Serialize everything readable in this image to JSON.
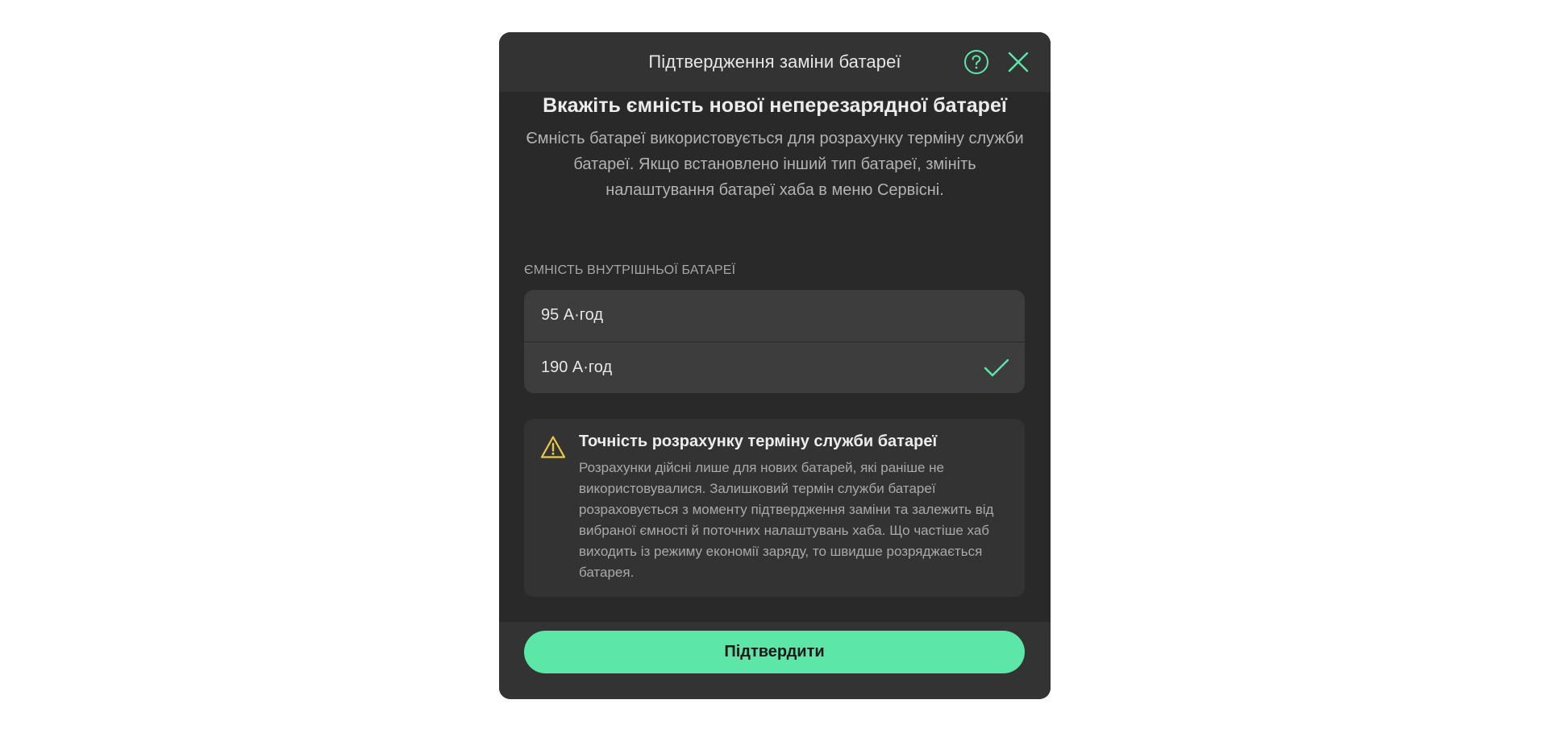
{
  "colors": {
    "accent": "#5ce6a8",
    "warning": "#e8c94a",
    "modal_background": "#292929",
    "header_background": "#333333",
    "option_background": "#3d3d3d"
  },
  "header": {
    "title": "Підтвердження заміни батареї",
    "help_icon": "help-circle-icon",
    "close_icon": "close-icon"
  },
  "main": {
    "heading": "Вкажіть ємність нової неперезарядної батареї",
    "description": "Ємність батареї використовується для розрахунку терміну служби батареї. Якщо встановлено інший тип батареї, змініть налаштування батареї хаба в меню Сервісні."
  },
  "capacity": {
    "label": "ЄМНІСТЬ ВНУТРІШНЬОЇ БАТАРЕЇ",
    "options": [
      {
        "label": "95 А·год",
        "selected": false
      },
      {
        "label": "190 А·год",
        "selected": true
      }
    ],
    "selected_icon": "checkmark-icon"
  },
  "warning": {
    "icon": "warning-triangle-icon",
    "title": "Точність розрахунку терміну служби батареї",
    "text": "Розрахунки дійсні лише для нових батарей, які раніше не використовувалися. Залишковий термін служби батареї розраховується з моменту підтвердження заміни та залежить від вибраної ємності й поточних налаштувань хаба. Що частіше хаб виходить із режиму економії заряду, то швидше розряджається батарея."
  },
  "footer": {
    "confirm_label": "Підтвердити"
  }
}
